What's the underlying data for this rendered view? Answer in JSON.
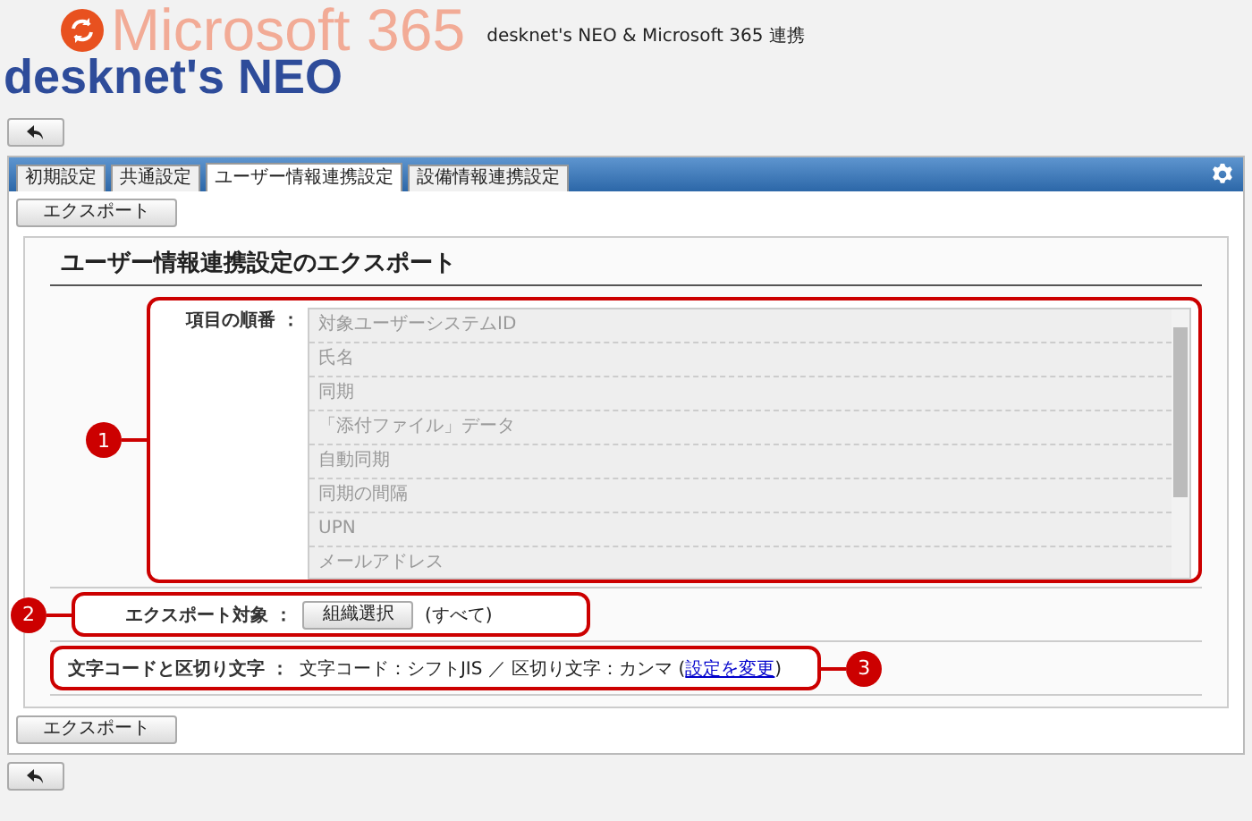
{
  "header": {
    "logo_top": "Microsoft 365",
    "logo_bottom": "desknet's NEO",
    "subtitle": "desknet's NEO & Microsoft 365 連携"
  },
  "tabs": [
    {
      "label": "初期設定",
      "selected": false
    },
    {
      "label": "共通設定",
      "selected": false
    },
    {
      "label": "ユーザー情報連携設定",
      "selected": true
    },
    {
      "label": "設備情報連携設定",
      "selected": false
    }
  ],
  "toolbar_button": "エクスポート",
  "section": {
    "title": "ユーザー情報連携設定のエクスポート",
    "fields": [
      {
        "kind": "list",
        "label": "項目の順番 ：",
        "marker": "1",
        "marker_right": false,
        "items": [
          "対象ユーザーシステムID",
          "氏名",
          "同期",
          "「添付ファイル」データ",
          "自動同期",
          "同期の間隔",
          "UPN",
          "メールアドレス"
        ]
      },
      {
        "kind": "button",
        "label": "エクスポート対象 ：",
        "marker": "2",
        "marker_right": false,
        "button": "組織選択",
        "value": "(すべて)"
      },
      {
        "kind": "text",
        "label": "文字コードと区切り文字 ：",
        "marker": "3",
        "marker_right": true,
        "value": "文字コード：シフトJIS ／ 区切り文字：カンマ (",
        "link": "設定を変更",
        "suffix": ")"
      }
    ]
  },
  "bottom_button": "エクスポート"
}
